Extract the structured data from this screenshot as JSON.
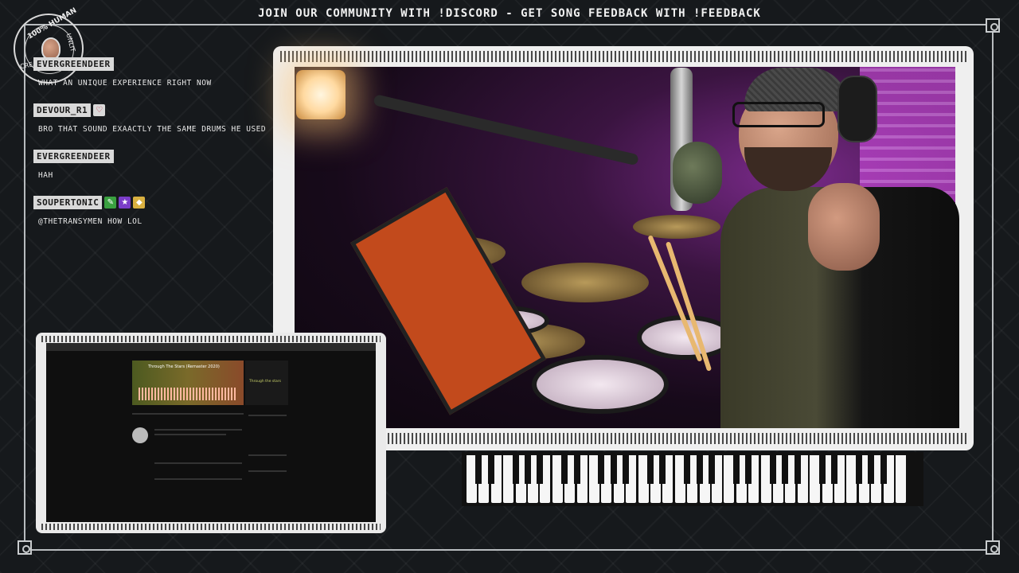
{
  "banner": {
    "text": "JOIN OUR COMMUNITY WITH !DISCORD - GET SONG FEEDBACK WITH !FEEDBACK"
  },
  "badge": {
    "top_text": "100% HUMAN",
    "right_text": "UNLIT",
    "bottom_text": "CREATED"
  },
  "chat": {
    "messages": [
      {
        "user": "EVERGREENDEER",
        "text": "WHAT AN UNIQUE EXPERIENCE RIGHT NOW",
        "badges": []
      },
      {
        "user": "DEVOUR_R1",
        "text": "BRO THAT SOUND EXAACTLY THE SAME DRUMS HE USED",
        "badges": [
          "heart-badge"
        ]
      },
      {
        "user": "EVERGREENDEER",
        "text": "HAH",
        "badges": []
      },
      {
        "user": "SOUPERTONIC",
        "text": "@THETRANSYMEN HOW LOL",
        "badges": [
          "green-badge",
          "purple-star-badge",
          "gold-badge"
        ]
      }
    ]
  },
  "screen_share": {
    "track_title": "Through The Stars (Remaster 2020)",
    "art_text": "Through the stars"
  },
  "colors": {
    "banner": "#f2f2f2",
    "username_bg": "#d9d9d9",
    "frame": "#efefef",
    "pad": "#c24a1c"
  }
}
